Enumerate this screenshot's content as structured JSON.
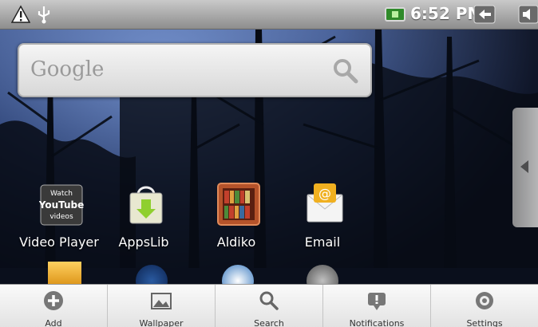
{
  "status_bar": {
    "time": "6:52 PM",
    "icons": [
      "warning-icon",
      "usb-icon",
      "battery-charging-icon",
      "back-icon",
      "volume-icon"
    ]
  },
  "search_widget": {
    "placeholder": "Google",
    "icon": "search-icon"
  },
  "apps": [
    {
      "label": "Video Player",
      "icon": "youtube-icon",
      "icon_text": [
        "Watch",
        "YouTube",
        "videos"
      ]
    },
    {
      "label": "AppsLib",
      "icon": "appslib-bag-icon"
    },
    {
      "label": "Aldiko",
      "icon": "bookshelf-icon"
    },
    {
      "label": "Email",
      "icon": "email-icon"
    }
  ],
  "menu": [
    {
      "label": "Add",
      "icon": "add-icon"
    },
    {
      "label": "Wallpaper",
      "icon": "wallpaper-icon"
    },
    {
      "label": "Search",
      "icon": "search-icon"
    },
    {
      "label": "Notifications",
      "icon": "notifications-icon"
    },
    {
      "label": "Settings",
      "icon": "settings-icon"
    }
  ],
  "colors": {
    "status_bar": "#a8a8a8",
    "battery": "#2f8a2a",
    "menu_bg": "#f0f0f0"
  }
}
